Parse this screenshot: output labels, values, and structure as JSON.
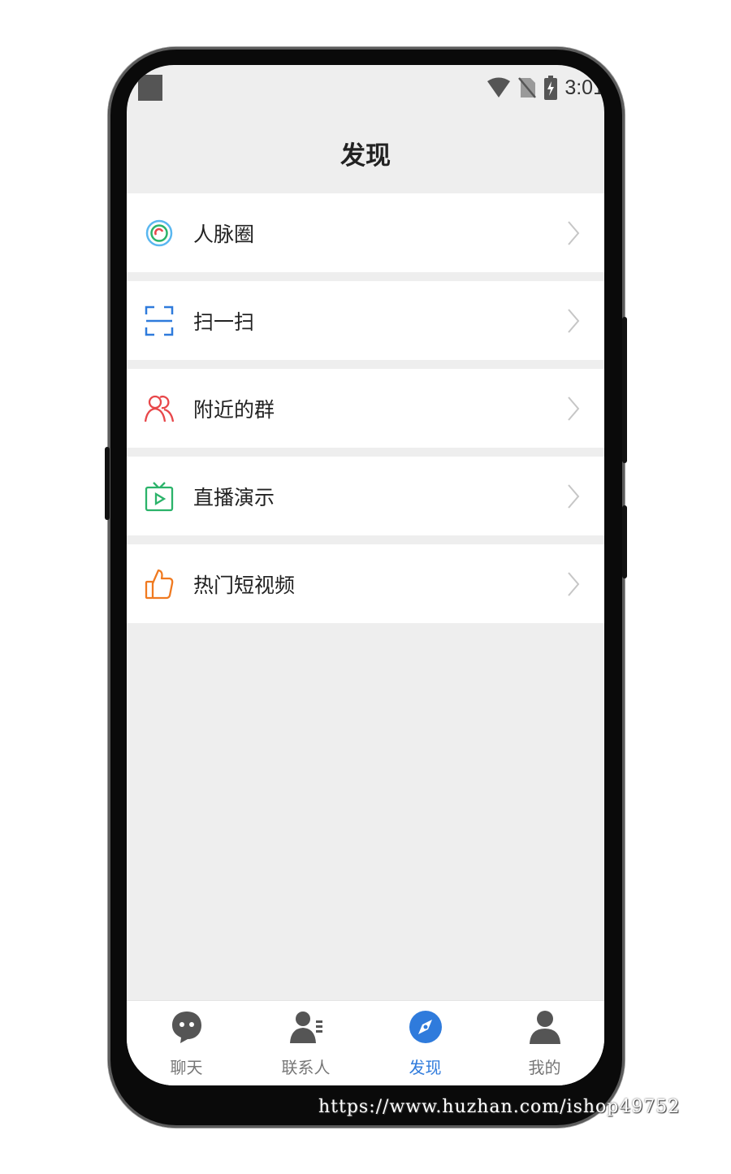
{
  "status_bar": {
    "time": "3:01"
  },
  "header": {
    "title": "发现"
  },
  "menu": [
    {
      "label": "人脉圈",
      "icon": "contacts-circle-icon",
      "color": "#3aa0e8"
    },
    {
      "label": "扫一扫",
      "icon": "scan-icon",
      "color": "#2f7bdc"
    },
    {
      "label": "附近的群",
      "icon": "nearby-group-icon",
      "color": "#e8474a"
    },
    {
      "label": "直播演示",
      "icon": "live-tv-icon",
      "color": "#2bb36a"
    },
    {
      "label": "热门短视频",
      "icon": "thumbs-up-icon",
      "color": "#f07a20"
    }
  ],
  "tabbar": {
    "active_color": "#2f7bdc",
    "items": [
      {
        "label": "聊天",
        "icon": "chat-icon"
      },
      {
        "label": "联系人",
        "icon": "contacts-icon"
      },
      {
        "label": "发现",
        "icon": "discover-compass-icon",
        "active": true
      },
      {
        "label": "我的",
        "icon": "profile-icon"
      }
    ]
  },
  "watermark": "https://www.huzhan.com/ishop49752"
}
